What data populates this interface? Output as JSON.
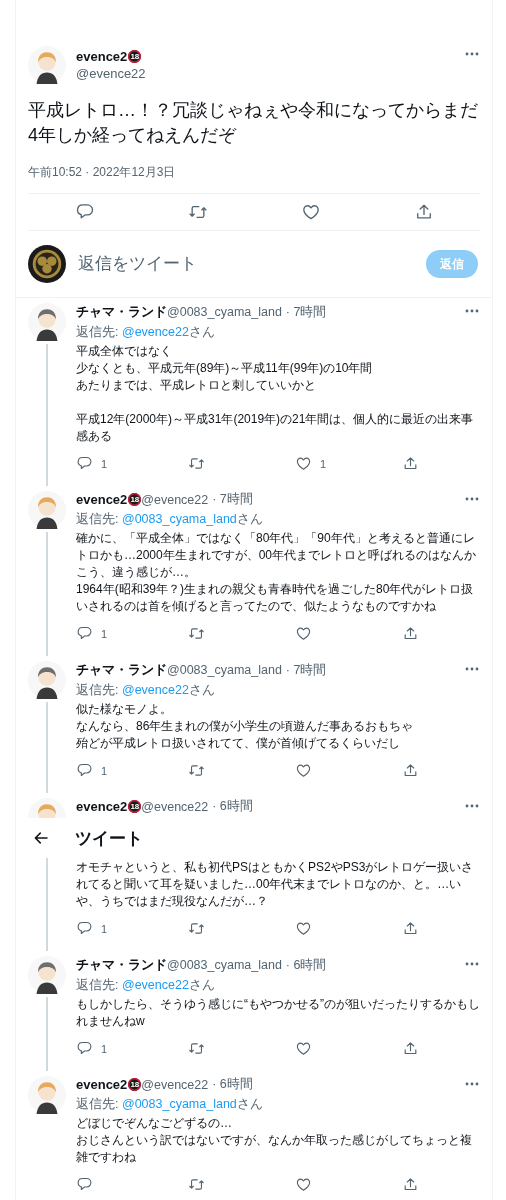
{
  "main_tweet": {
    "author": {
      "name": "evence2",
      "badge": "18",
      "handle": "@evence22",
      "kind": "blonde"
    },
    "text": "平成レトロ…！？冗談じゃねぇや令和になってからまだ4年しか経ってねえんだぞ",
    "timestamp": "午前10:52 · 2022年12月3日",
    "actions": [
      {
        "kind": "reply"
      },
      {
        "kind": "retweet"
      },
      {
        "kind": "like"
      },
      {
        "kind": "share"
      }
    ]
  },
  "reply_composer": {
    "placeholder": "返信をツイート",
    "button": "返信",
    "disabled": true
  },
  "replies": [
    {
      "author": {
        "name": "チャマ・ランド",
        "handle": "@0083_cyama_land",
        "kind": "grey"
      },
      "time": "· 7時間",
      "reply_to": {
        "prefix": "返信先: ",
        "mention": "@evence22",
        "suffix": "さん"
      },
      "blocks": [
        [
          "平成全体ではなく",
          "少なくとも、平成元年(89年)～平成11年(99年)の10年間",
          "あたりまでは、平成レトロと刺していいかと"
        ],
        [
          "平成12年(2000年)～平成31年(2019年)の21年間は、個人的に最近の出来事感ある"
        ]
      ],
      "actions": [
        {
          "kind": "reply",
          "count": "1"
        },
        {
          "kind": "retweet"
        },
        {
          "kind": "like",
          "count": "1"
        },
        {
          "kind": "share"
        }
      ]
    },
    {
      "author": {
        "name": "evence2",
        "badge": "18",
        "handle": "@evence22",
        "kind": "blonde"
      },
      "time": "· 7時間",
      "reply_to": {
        "prefix": "返信先: ",
        "mention": "@0083_cyama_land",
        "suffix": "さん"
      },
      "blocks": [
        [
          "確かに、「平成全体」ではなく「80年代」「90年代」と考えると普通にレトロかも…2000年生まれですが、00年代までレトロと呼ばれるのはなんかこう、違う感じが…。",
          "1964年(昭和39年？)生まれの親父も青春時代を過ごした80年代がレトロ扱いされるのは首を傾げると言ってたので、似たようなものですかね"
        ]
      ],
      "actions": [
        {
          "kind": "reply",
          "count": "1"
        },
        {
          "kind": "retweet"
        },
        {
          "kind": "like"
        },
        {
          "kind": "share"
        }
      ]
    },
    {
      "author": {
        "name": "チャマ・ランド",
        "handle": "@0083_cyama_land",
        "kind": "grey"
      },
      "time": "· 7時間",
      "reply_to": {
        "prefix": "返信先: ",
        "mention": "@evence22",
        "suffix": "さん"
      },
      "blocks": [
        [
          "似た様なモノよ。",
          "なんなら、86年生まれの僕が小学生の頃遊んだ事あるおもちゃ",
          "殆どが平成レトロ扱いされてて、僕が首傾げてるくらいだし"
        ]
      ],
      "actions": [
        {
          "kind": "reply",
          "count": "1"
        },
        {
          "kind": "retweet"
        },
        {
          "kind": "like"
        },
        {
          "kind": "share"
        }
      ]
    },
    {
      "author": {
        "name": "evence2",
        "badge": "18",
        "handle": "@evence22",
        "kind": "blonde"
      },
      "time": "· 6時間",
      "header_overlay": {
        "title": "ツイート"
      },
      "blocks": [
        [
          "オモチャというと、私も初代PSはともかくPS2やPS3がレトロゲー扱いされてると聞いて耳を疑いました…00年代末までレトロなのか、と。…いや、うちではまだ現役なんだが…？"
        ]
      ],
      "actions": [
        {
          "kind": "reply",
          "count": "1"
        },
        {
          "kind": "retweet"
        },
        {
          "kind": "like"
        },
        {
          "kind": "share"
        }
      ]
    },
    {
      "author": {
        "name": "チャマ・ランド",
        "handle": "@0083_cyama_land",
        "kind": "grey"
      },
      "time": "· 6時間",
      "reply_to": {
        "prefix": "返信先: ",
        "mention": "@evence22",
        "suffix": "さん"
      },
      "blocks": [
        [
          "もしかしたら、そうゆう感じに“もやつかせる”のが狙いだったりするかもしれませんねw"
        ]
      ],
      "actions": [
        {
          "kind": "reply",
          "count": "1"
        },
        {
          "kind": "retweet"
        },
        {
          "kind": "like"
        },
        {
          "kind": "share"
        }
      ]
    },
    {
      "author": {
        "name": "evence2",
        "badge": "18",
        "handle": "@evence22",
        "kind": "blonde"
      },
      "time": "· 6時間",
      "reply_to": {
        "prefix": "返信先: ",
        "mention": "@0083_cyama_land",
        "suffix": "さん"
      },
      "blocks": [
        [
          "どぼじでぞんなごどずるの…",
          "おじさんという訳ではないですが、なんか年取った感じがしてちょっと複雑ですわね"
        ]
      ],
      "actions": [
        {
          "kind": "reply"
        },
        {
          "kind": "retweet"
        },
        {
          "kind": "like"
        },
        {
          "kind": "share"
        }
      ]
    }
  ]
}
